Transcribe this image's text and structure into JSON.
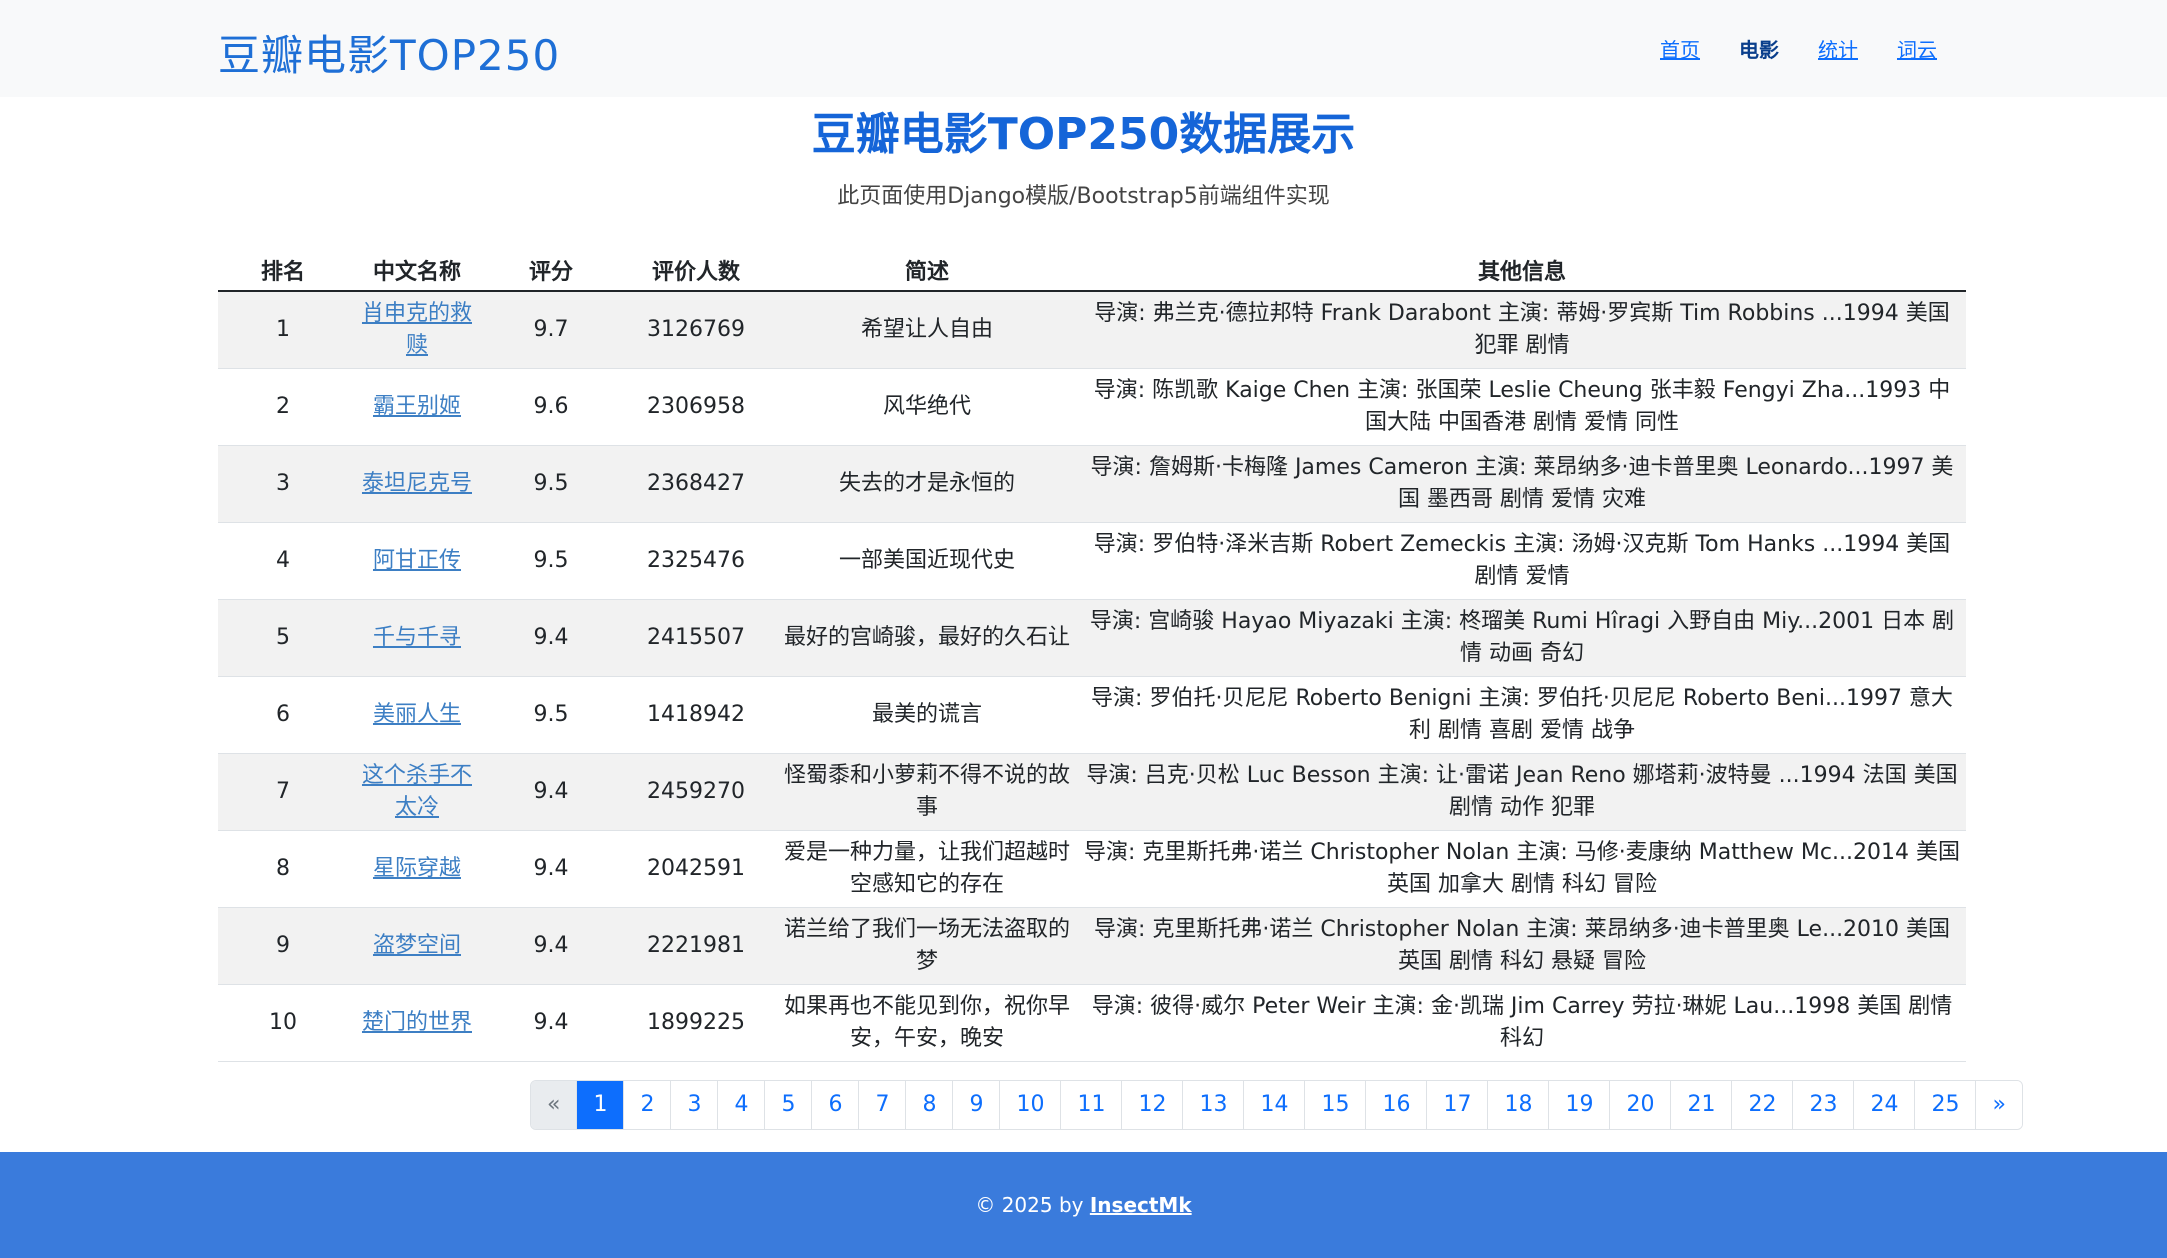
{
  "navbar": {
    "brand": "豆瓣电影TOP250",
    "links": [
      {
        "label": "首页",
        "active": false
      },
      {
        "label": "电影",
        "active": true
      },
      {
        "label": "统计",
        "active": false
      },
      {
        "label": "词云",
        "active": false
      }
    ]
  },
  "page": {
    "title": "豆瓣电影TOP250数据展示",
    "subtitle": "此页面使用Django模版/Bootstrap5前端组件实现"
  },
  "table": {
    "headers": [
      "排名",
      "中文名称",
      "评分",
      "评价人数",
      "简述",
      "其他信息"
    ],
    "rows": [
      {
        "rank": "1",
        "name": "肖申克的救赎",
        "score": "9.7",
        "votes": "3126769",
        "brief": "希望让人自由",
        "info": "导演: 弗兰克·德拉邦特 Frank Darabont   主演: 蒂姆·罗宾斯 Tim Robbins ...1994  美国  犯罪 剧情"
      },
      {
        "rank": "2",
        "name": "霸王别姬",
        "score": "9.6",
        "votes": "2306958",
        "brief": "风华绝代",
        "info": "导演: 陈凯歌 Kaige Chen   主演: 张国荣 Leslie Cheung 张丰毅 Fengyi Zha...1993  中国大陆 中国香港  剧情 爱情 同性"
      },
      {
        "rank": "3",
        "name": "泰坦尼克号",
        "score": "9.5",
        "votes": "2368427",
        "brief": "失去的才是永恒的",
        "info": "导演: 詹姆斯·卡梅隆 James Cameron   主演: 莱昂纳多·迪卡普里奥 Leonardo...1997  美国 墨西哥  剧情 爱情 灾难"
      },
      {
        "rank": "4",
        "name": "阿甘正传",
        "score": "9.5",
        "votes": "2325476",
        "brief": "一部美国近现代史",
        "info": "导演: 罗伯特·泽米吉斯 Robert Zemeckis   主演: 汤姆·汉克斯 Tom Hanks ...1994  美国  剧情 爱情"
      },
      {
        "rank": "5",
        "name": "千与千寻",
        "score": "9.4",
        "votes": "2415507",
        "brief": "最好的宫崎骏，最好的久石让",
        "info": "导演: 宫崎骏 Hayao Miyazaki   主演: 柊瑠美 Rumi Hîragi 入野自由 Miy...2001  日本  剧情 动画 奇幻"
      },
      {
        "rank": "6",
        "name": "美丽人生",
        "score": "9.5",
        "votes": "1418942",
        "brief": "最美的谎言",
        "info": "导演: 罗伯托·贝尼尼 Roberto Benigni   主演: 罗伯托·贝尼尼 Roberto Beni...1997  意大利  剧情 喜剧 爱情 战争"
      },
      {
        "rank": "7",
        "name": "这个杀手不太冷",
        "score": "9.4",
        "votes": "2459270",
        "brief": "怪蜀黍和小萝莉不得不说的故事",
        "info": "导演: 吕克·贝松 Luc Besson   主演: 让·雷诺 Jean Reno 娜塔莉·波特曼 ...1994  法国 美国  剧情 动作 犯罪"
      },
      {
        "rank": "8",
        "name": "星际穿越",
        "score": "9.4",
        "votes": "2042591",
        "brief": "爱是一种力量，让我们超越时空感知它的存在",
        "info": "导演: 克里斯托弗·诺兰 Christopher Nolan   主演: 马修·麦康纳 Matthew Mc...2014  美国 英国 加拿大  剧情 科幻 冒险"
      },
      {
        "rank": "9",
        "name": "盗梦空间",
        "score": "9.4",
        "votes": "2221981",
        "brief": "诺兰给了我们一场无法盗取的梦",
        "info": "导演: 克里斯托弗·诺兰 Christopher Nolan   主演: 莱昂纳多·迪卡普里奥 Le...2010  美国 英国  剧情 科幻 悬疑 冒险"
      },
      {
        "rank": "10",
        "name": "楚门的世界",
        "score": "9.4",
        "votes": "1899225",
        "brief": "如果再也不能见到你，祝你早安，午安，晚安",
        "info": "导演: 彼得·威尔 Peter Weir   主演: 金·凯瑞 Jim Carrey 劳拉·琳妮 Lau...1998  美国  剧情 科幻"
      }
    ]
  },
  "pagination": {
    "prev": "«",
    "next": "»",
    "current": "1",
    "pages": [
      "1",
      "2",
      "3",
      "4",
      "5",
      "6",
      "7",
      "8",
      "9",
      "10",
      "11",
      "12",
      "13",
      "14",
      "15",
      "16",
      "17",
      "18",
      "19",
      "20",
      "21",
      "22",
      "23",
      "24",
      "25"
    ]
  },
  "footer": {
    "prefix": "© 2025 by",
    "author": "InsectMk"
  },
  "colors": {
    "primary": "#0d6efd",
    "brand": "#1e6fd6",
    "footer_bg": "#3a7bdc",
    "navbar_bg": "#f8f9fa"
  }
}
